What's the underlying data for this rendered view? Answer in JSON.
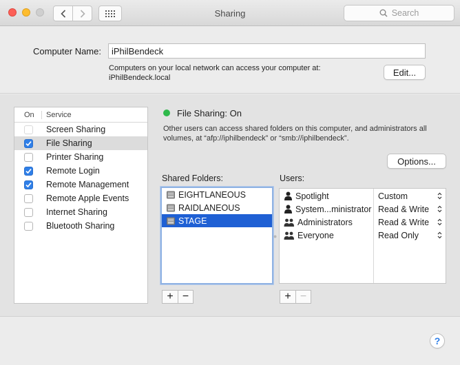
{
  "window": {
    "title": "Sharing",
    "search_placeholder": "Search"
  },
  "computer": {
    "label": "Computer Name:",
    "name": "iPhilBendeck",
    "network_line1": "Computers on your local network can access your computer at:",
    "network_line2": "iPhilBendeck.local",
    "edit_label": "Edit..."
  },
  "services": {
    "header_on": "On",
    "header_service": "Service",
    "items": [
      {
        "label": "Screen Sharing",
        "checked": false,
        "enabled": false,
        "selected": false
      },
      {
        "label": "File Sharing",
        "checked": true,
        "enabled": true,
        "selected": true
      },
      {
        "label": "Printer Sharing",
        "checked": false,
        "enabled": true,
        "selected": false
      },
      {
        "label": "Remote Login",
        "checked": true,
        "enabled": true,
        "selected": false
      },
      {
        "label": "Remote Management",
        "checked": true,
        "enabled": true,
        "selected": false
      },
      {
        "label": "Remote Apple Events",
        "checked": false,
        "enabled": true,
        "selected": false
      },
      {
        "label": "Internet Sharing",
        "checked": false,
        "enabled": true,
        "selected": false
      },
      {
        "label": "Bluetooth Sharing",
        "checked": false,
        "enabled": true,
        "selected": false
      }
    ]
  },
  "file_sharing": {
    "status": "File Sharing: On",
    "status_color": "#2fb94b",
    "description": "Other users can access shared folders on this computer, and administrators all volumes, at “afp://iphilbendeck” or “smb://iphilbendeck”.",
    "options_label": "Options...",
    "shared_folders_label": "Shared Folders:",
    "users_label": "Users:",
    "folders": [
      {
        "name": "EIGHTLANEOUS",
        "selected": false
      },
      {
        "name": "RAIDLANEOUS",
        "selected": false
      },
      {
        "name": "STAGE",
        "selected": true
      }
    ],
    "users": [
      {
        "name": "Spotlight",
        "icon": "single-user-icon",
        "permission": "Custom"
      },
      {
        "name": "System...ministrator",
        "icon": "single-user-icon",
        "permission": "Read & Write"
      },
      {
        "name": "Administrators",
        "icon": "user-group-icon",
        "permission": "Read & Write"
      },
      {
        "name": "Everyone",
        "icon": "user-group-icon",
        "permission": "Read Only"
      }
    ]
  },
  "controls": {
    "plus": "+",
    "minus": "−",
    "help": "?"
  },
  "colors": {
    "accent": "#2f7fe8",
    "selection": "#1f60d4"
  }
}
